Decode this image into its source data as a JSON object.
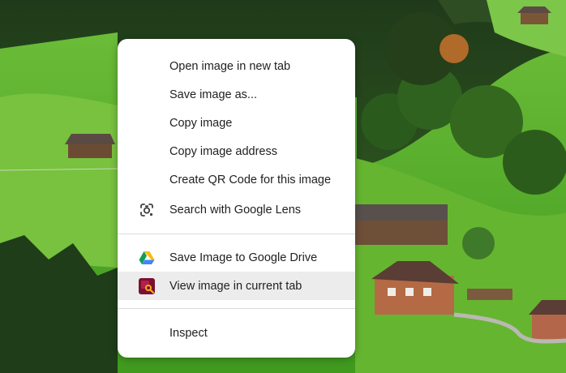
{
  "context_menu": {
    "group_1": [
      {
        "label": "Open image in new tab",
        "icon": ""
      },
      {
        "label": "Save image as...",
        "icon": ""
      },
      {
        "label": "Copy image",
        "icon": ""
      },
      {
        "label": "Copy image address",
        "icon": ""
      },
      {
        "label": "Create QR Code for this image",
        "icon": ""
      },
      {
        "label": "Search with Google Lens",
        "icon": "google-lens-icon"
      }
    ],
    "group_2": [
      {
        "label": "Save Image to Google Drive",
        "icon": "google-drive-icon"
      },
      {
        "label": "View image in current tab",
        "icon": "view-image-extension-icon",
        "hovered": true
      }
    ],
    "group_3": [
      {
        "label": "Inspect",
        "icon": ""
      }
    ]
  },
  "colors": {
    "menu_background": "#ffffff",
    "hover_background": "#ececec",
    "text": "#1f1f1f",
    "separator": "#dadce0"
  }
}
